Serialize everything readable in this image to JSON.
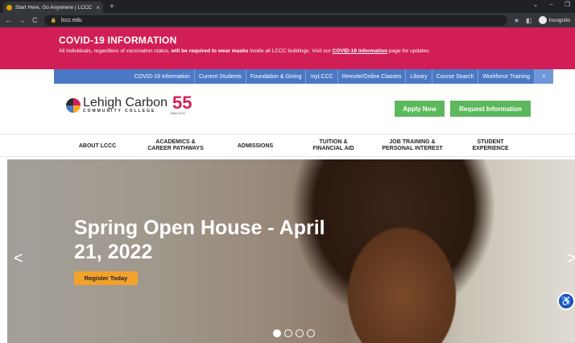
{
  "browser": {
    "tab_title": "Start Here, Go Anywhere | LCCC",
    "tab_close": "×",
    "new_tab": "+",
    "url": "lccc.edu",
    "incognito_label": "Incognito"
  },
  "covid": {
    "title": "COVID-19 INFORMATION",
    "text_pre": "All individuals, regardless of vaccination status, ",
    "text_bold": "will be required to wear masks",
    "text_mid": " inside all LCCC buildings. Visit our ",
    "link": "COVID-19 information",
    "text_post": " page for updates."
  },
  "utility_nav": [
    "COVID-19 Information",
    "Current Students",
    "Foundation & Giving",
    "myLCCC",
    "Remote/Online Classes",
    "Library",
    "Course Search",
    "Workforce Training"
  ],
  "logo": {
    "name": "Lehigh Carbon",
    "sub": "COMMUNITY COLLEGE",
    "anniv": "55",
    "years": "1966-2021"
  },
  "cta": {
    "apply": "Apply Now",
    "request": "Request Information"
  },
  "main_nav": {
    "about": "ABOUT LCCC",
    "academics_1": "ACADEMICS &",
    "academics_2": "CAREER PATHWAYS",
    "admissions": "ADMISSIONS",
    "tuition_1": "TUITION &",
    "tuition_2": "FINANCIAL AID",
    "job_1": "JOB TRAINING &",
    "job_2": "PERSONAL INTEREST",
    "student_1": "STUDENT",
    "student_2": "EXPERIENCE"
  },
  "hero": {
    "title_line1": "Spring Open House - April",
    "title_line2": "21, 2022",
    "button": "Register Today",
    "slides": 4,
    "active_slide": 1
  },
  "colors": {
    "covid_bg": "#d21e57",
    "utility_bg": "#4a78c4",
    "cta_green": "#5cb85c",
    "register_orange": "#f2a22b"
  }
}
